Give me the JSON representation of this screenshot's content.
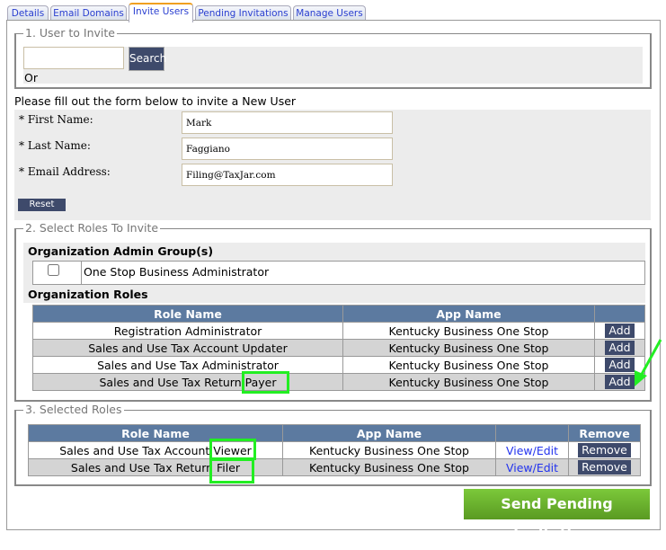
{
  "tabs": [
    "Details",
    "Email Domains",
    "Invite Users",
    "Pending Invitations",
    "Manage Users"
  ],
  "section1": {
    "legend": "1. User to Invite",
    "search_value": "",
    "search_label": "Search",
    "or_label": "Or"
  },
  "form": {
    "intro": "Please fill out the form below to invite a New User",
    "first_name_label": "* First Name:",
    "first_name": "Mark",
    "last_name_label": "* Last Name:",
    "last_name": "Faggiano",
    "email_label": "* Email Address:",
    "email": "Filing@TaxJar.com",
    "reset_label": "Reset"
  },
  "section2": {
    "legend": "2. Select Roles To Invite",
    "admin_group_heading": "Organization Admin Group(s)",
    "admin_group_item": "One Stop Business Administrator",
    "roles_heading": "Organization Roles",
    "columns": [
      "Role Name",
      "App Name",
      ""
    ],
    "rows": [
      {
        "role": "Registration Administrator",
        "app": "Kentucky Business One Stop",
        "action": "Add"
      },
      {
        "role": "Sales and Use Tax Account Updater",
        "app": "Kentucky Business One Stop",
        "action": "Add"
      },
      {
        "role": "Sales and Use Tax Administrator",
        "app": "Kentucky Business One Stop",
        "action": "Add"
      },
      {
        "role": "Sales and Use Tax Return Payer",
        "app": "Kentucky Business One Stop",
        "action": "Add"
      }
    ]
  },
  "section3": {
    "legend": "3. Selected Roles",
    "columns": [
      "Role Name",
      "App Name",
      "",
      "Remove"
    ],
    "rows": [
      {
        "role": "Sales and Use Tax Account Viewer",
        "app": "Kentucky Business One Stop",
        "link": "View/Edit",
        "action": "Remove"
      },
      {
        "role": "Sales and Use Tax Return Filer",
        "app": "Kentucky Business One Stop",
        "link": "View/Edit",
        "action": "Remove"
      }
    ]
  },
  "send_label": "Send Pending Invitations",
  "colors": {
    "header": "#5c7aa0",
    "button": "#3e4a6b",
    "send": "#6aae2a",
    "highlight": "#22ee22"
  }
}
